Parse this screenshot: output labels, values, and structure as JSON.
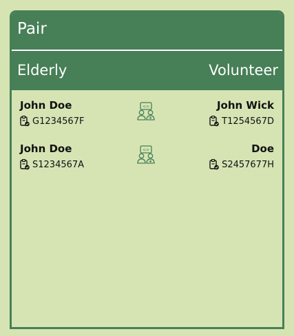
{
  "panel": {
    "title": "Pair",
    "header_left": "Elderly",
    "header_right": "Volunteer"
  },
  "pairs": [
    {
      "elderly_name": "John Doe",
      "elderly_id": "G1234567F",
      "volunteer_name": "John Wick",
      "volunteer_id": "T1254567D"
    },
    {
      "elderly_name": "John Doe",
      "elderly_id": "S1234567A",
      "volunteer_name": "Doe",
      "volunteer_id": "S2457677H"
    }
  ],
  "colors": {
    "background": "#d6e4b4",
    "accent": "#477f56",
    "header_text": "#ffffff"
  },
  "icons": {
    "pair": "pair-people-icon",
    "id": "id-badge-check-icon"
  }
}
